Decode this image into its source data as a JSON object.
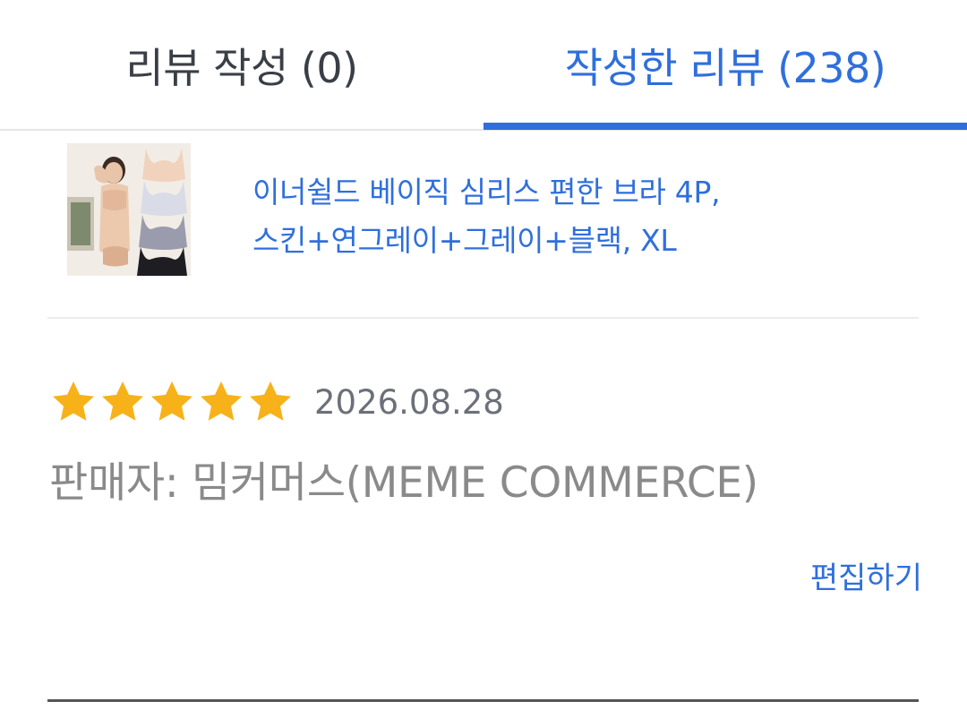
{
  "tabs": {
    "write_label": "리뷰 작성 (0)",
    "written_label": "작성한 리뷰 (238)",
    "active": "written"
  },
  "product": {
    "name_line1": "이너쉴드 베이직 심리스 편한 브라 4P,",
    "name_line2": "스킨+연그레이+그레이+블랙, XL",
    "image_icon": "product-photo"
  },
  "review": {
    "rating": 5,
    "max_rating": 5,
    "date": "2026.08.28",
    "seller": "판매자: 밈커머스(MEME COMMERCE)",
    "edit_label": "편집하기"
  },
  "colors": {
    "accent": "#2f6fdc",
    "star": "#f7b21a",
    "muted_text": "#8a8a8a"
  }
}
